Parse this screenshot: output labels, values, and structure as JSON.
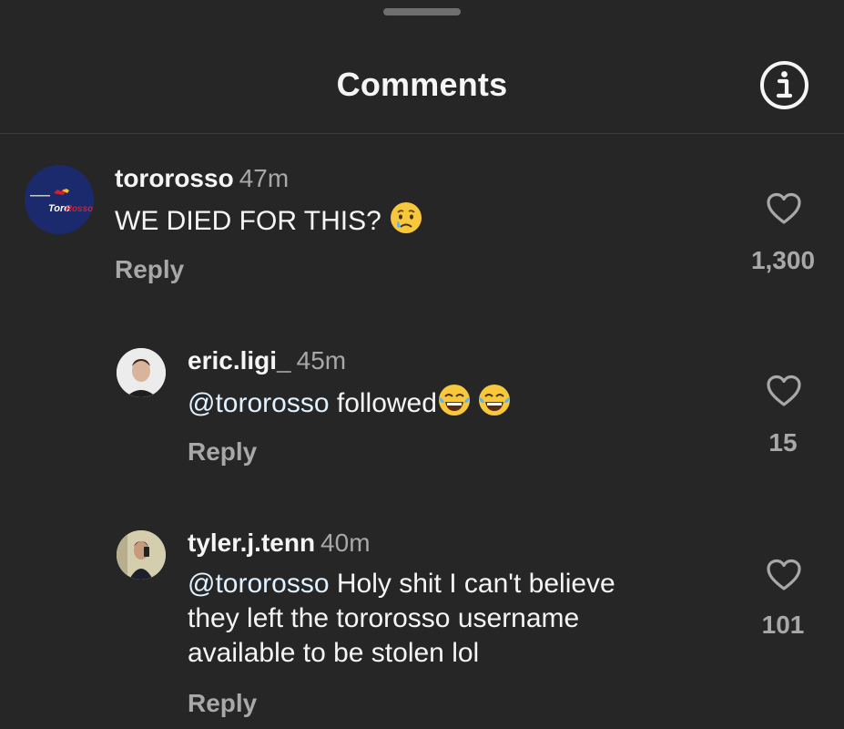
{
  "header": {
    "title": "Comments",
    "info_icon": "info-icon"
  },
  "comments": [
    {
      "username": "tororosso",
      "time": "47m",
      "text": "WE DIED FOR THIS?",
      "emoji": "crying-face",
      "reply_label": "Reply",
      "like_count": "1,300",
      "avatar_logo_text": "Toro Rosso"
    },
    {
      "username": "eric.ligi_",
      "time": "45m",
      "mention": "@tororosso",
      "text": "followed",
      "emoji": "tears-of-joy",
      "reply_label": "Reply",
      "like_count": "15"
    },
    {
      "username": "tyler.j.tenn",
      "time": "40m",
      "mention": "@tororosso",
      "text_line1": "Holy shit I can't believe",
      "text_line2": "they left the tororosso username",
      "text_line3": "available to be stolen lol",
      "reply_label": "Reply",
      "like_count": "101"
    }
  ],
  "colors": {
    "background": "#262626",
    "primary_text": "#f5f5f5",
    "secondary_text": "#a8a8a8",
    "brand_blue": "#1b2a6b",
    "brand_red": "#d6202c"
  }
}
